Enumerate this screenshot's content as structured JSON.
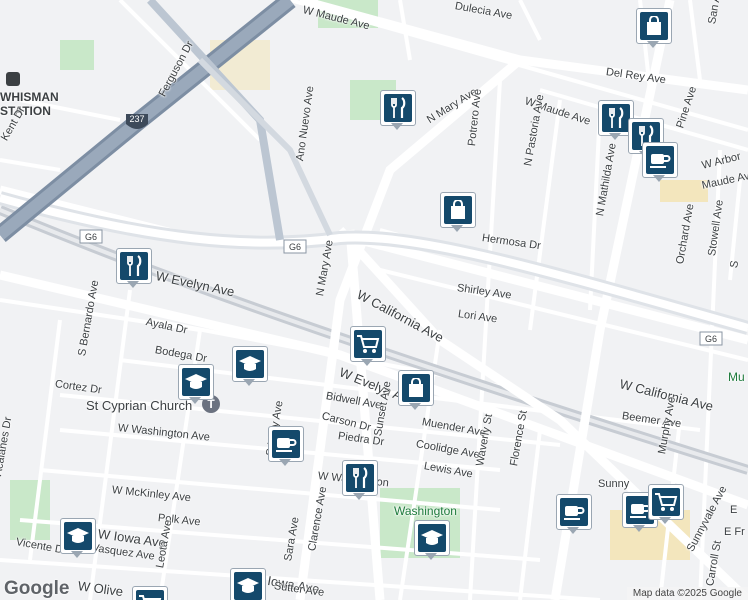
{
  "map": {
    "labels": {
      "w_maude_top": "W Maude Ave",
      "w_maude_mid": "W Maude Ave",
      "maude_right": "Maude Ave",
      "dulecia": "Dulecia Ave",
      "del_rey": "Del Rey Ave",
      "san_ale": "San Ale",
      "whisman": "WHISMAN",
      "station": "STATION",
      "kent": "Kent Dr",
      "ferguson": "Ferguson Dr",
      "ano_nuevo": "Ano Nuevo Ave",
      "n_mary_top": "N Mary Ave",
      "potrero": "Potrero Ave",
      "n_pastoria": "N Pastoria Ave",
      "n_mathilda": "N Mathilda Ave",
      "pine": "Pine Ave",
      "w_arbor": "W Arbor",
      "hermosa": "Hermosa Dr",
      "stowell": "Stowell Ave",
      "orchard": "Orchard Ave",
      "s_side": "S",
      "g6_left": "G6",
      "g6_mid": "G6",
      "g6_right": "G6",
      "route_237": "237",
      "w_evelyn": "W Evelyn Ave",
      "w_evelyn_2": "W Evelyn Ave",
      "n_mary_mid": "N Mary Ave",
      "w_california": "W California Ave",
      "w_california_2": "W California Ave",
      "shirley": "Shirley Ave",
      "lori": "Lori Ave",
      "s_bernardo": "S Bernardo Ave",
      "ayala": "Ayala Dr",
      "bodega": "Bodega Dr",
      "cortez": "Cortez Dr",
      "st_cyprian": "St Cyprian Church",
      "w_washington": "W Washington Ave",
      "acalanes": "Acalanes Dr",
      "bidwell": "Bidwell Ave",
      "carson": "Carson Dr",
      "piedra": "Piedra Dr",
      "sunset": "Sunset Ave",
      "muender": "Muender Ave",
      "coolidge": "Coolidge Ave",
      "lewis": "Lewis Ave",
      "beemer": "Beemer Ave",
      "waverly": "Waverly St",
      "florence": "Florence St",
      "murphy": "Murphy Ave",
      "s_mary": "S Mary Ave",
      "w_washington_2": "W Washington",
      "w_mckinley": "W McKinley Ave",
      "polk": "Polk Ave",
      "w_iowa": "W Iowa Ave",
      "w_iowa_2": "W Iowa Ave",
      "vasquez": "Vasquez Ave",
      "vicente": "Vicente Dr",
      "w_olive": "W Olive",
      "leota": "Leota Ave",
      "sara": "Sara Ave",
      "clarence": "Clarence Ave",
      "sutter": "Sutter Ave",
      "washington_park": "Washington",
      "sunny": "Sunny",
      "sunnyvale_ave": "Sunnyvale Ave",
      "carroll": "Carroll St",
      "e_fr": "E Fr",
      "e_right": "E",
      "mu": "Mu"
    },
    "pins": [
      {
        "kind": "shopping",
        "icon": "shopping-bag-icon"
      },
      {
        "kind": "restaurant",
        "icon": "fork-knife-icon"
      },
      {
        "kind": "restaurant",
        "icon": "fork-knife-icon"
      },
      {
        "kind": "restaurant",
        "icon": "fork-knife-icon"
      },
      {
        "kind": "cafe",
        "icon": "coffee-cup-icon"
      },
      {
        "kind": "shopping",
        "icon": "shopping-bag-icon"
      },
      {
        "kind": "restaurant",
        "icon": "fork-knife-icon"
      },
      {
        "kind": "grocery",
        "icon": "shopping-cart-icon"
      },
      {
        "kind": "school",
        "icon": "graduation-cap-icon"
      },
      {
        "kind": "school",
        "icon": "graduation-cap-icon"
      },
      {
        "kind": "shopping",
        "icon": "shopping-bag-icon"
      },
      {
        "kind": "cafe",
        "icon": "coffee-cup-icon"
      },
      {
        "kind": "restaurant",
        "icon": "fork-knife-icon"
      },
      {
        "kind": "school",
        "icon": "graduation-cap-icon"
      },
      {
        "kind": "school",
        "icon": "graduation-cap-icon"
      },
      {
        "kind": "school",
        "icon": "graduation-cap-icon"
      },
      {
        "kind": "cafe",
        "icon": "coffee-cup-icon"
      },
      {
        "kind": "cafe",
        "icon": "coffee-cup-icon"
      },
      {
        "kind": "grocery",
        "icon": "shopping-cart-icon"
      },
      {
        "kind": "grocery",
        "icon": "shopping-cart-icon"
      }
    ],
    "colors": {
      "background": "#f1f2f4",
      "road": "#ffffff",
      "highway": "#9aa9bb",
      "highway_dark": "#7d8ea3",
      "rail": "#c7ccd3",
      "park": "#c9e8c9",
      "pin_fill": "#14496b",
      "pin_border": "#9aa6b2"
    },
    "footer": {
      "logo": "Google",
      "attribution": "Map data ©2025 Google"
    }
  }
}
